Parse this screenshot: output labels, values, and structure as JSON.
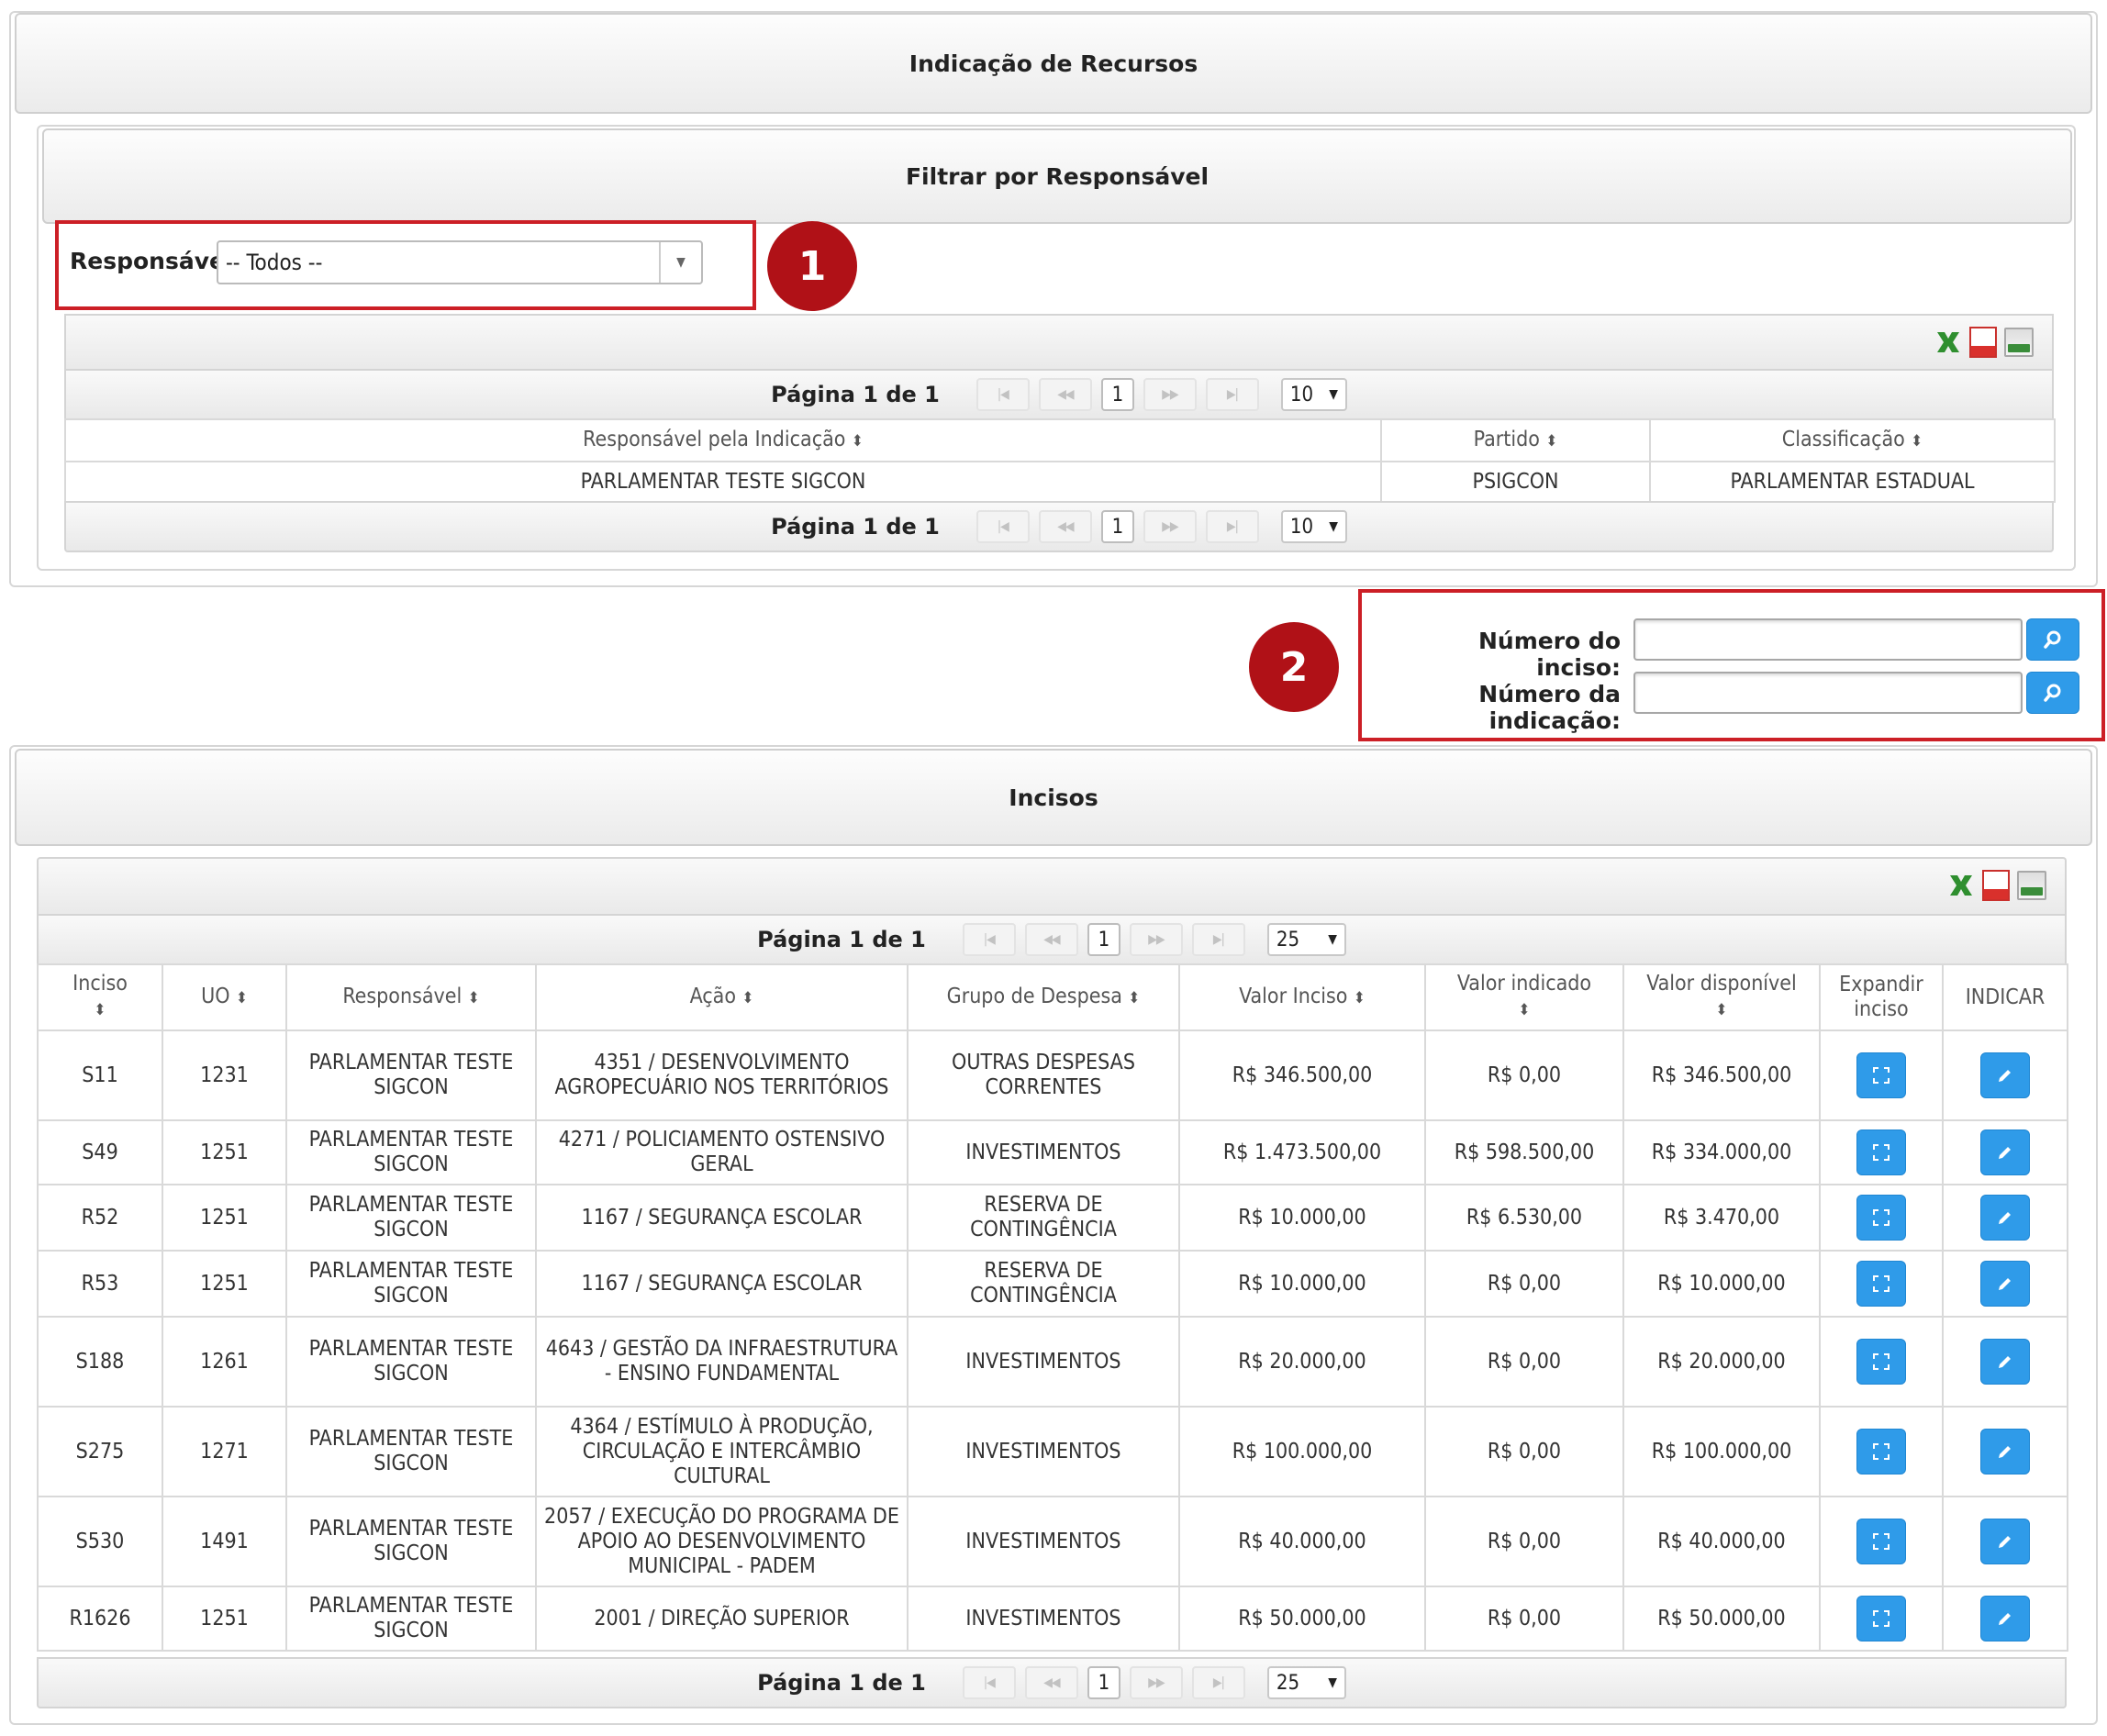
{
  "page": {
    "title": "Indicação de Recursos"
  },
  "filter": {
    "title": "Filtrar por Responsável",
    "label": "Responsável:",
    "selected": "-- Todos --"
  },
  "badges": {
    "one": "1",
    "two": "2"
  },
  "resp_table": {
    "pager": {
      "label": "Página 1 de 1",
      "current": "1",
      "size": "10"
    },
    "columns": [
      "Responsável pela Indicação",
      "Partido",
      "Classificação"
    ],
    "rows": [
      [
        "PARLAMENTAR TESTE SIGCON",
        "PSIGCON",
        "PARLAMENTAR ESTADUAL"
      ]
    ]
  },
  "search": {
    "inciso_label": "Número do inciso:",
    "indicacao_label": "Número da indicação:",
    "inciso_value": "",
    "indicacao_value": ""
  },
  "incisos": {
    "title": "Incisos",
    "pager": {
      "label": "Página 1 de 1",
      "current": "1",
      "size": "25"
    },
    "columns": [
      "Inciso",
      "UO",
      "Responsável",
      "Ação",
      "Grupo de Despesa",
      "Valor Inciso",
      "Valor indicado",
      "Valor disponível",
      "Expandir inciso",
      "INDICAR"
    ],
    "rows": [
      [
        "S11",
        "1231",
        "PARLAMENTAR TESTE SIGCON",
        "4351 / DESENVOLVIMENTO AGROPECUÁRIO NOS TERRITÓRIOS",
        "OUTRAS DESPESAS CORRENTES",
        "R$ 346.500,00",
        "R$ 0,00",
        "R$ 346.500,00"
      ],
      [
        "S49",
        "1251",
        "PARLAMENTAR TESTE SIGCON",
        "4271 / POLICIAMENTO OSTENSIVO GERAL",
        "INVESTIMENTOS",
        "R$ 1.473.500,00",
        "R$ 598.500,00",
        "R$ 334.000,00"
      ],
      [
        "R52",
        "1251",
        "PARLAMENTAR TESTE SIGCON",
        "1167 / SEGURANÇA ESCOLAR",
        "RESERVA DE CONTINGÊNCIA",
        "R$ 10.000,00",
        "R$ 6.530,00",
        "R$ 3.470,00"
      ],
      [
        "R53",
        "1251",
        "PARLAMENTAR TESTE SIGCON",
        "1167 / SEGURANÇA ESCOLAR",
        "RESERVA DE CONTINGÊNCIA",
        "R$ 10.000,00",
        "R$ 0,00",
        "R$ 10.000,00"
      ],
      [
        "S188",
        "1261",
        "PARLAMENTAR TESTE SIGCON",
        "4643 / GESTÃO DA INFRAESTRUTURA - ENSINO FUNDAMENTAL",
        "INVESTIMENTOS",
        "R$ 20.000,00",
        "R$ 0,00",
        "R$ 20.000,00"
      ],
      [
        "S275",
        "1271",
        "PARLAMENTAR TESTE SIGCON",
        "4364 / ESTÍMULO À PRODUÇÃO, CIRCULAÇÃO E INTERCÂMBIO CULTURAL",
        "INVESTIMENTOS",
        "R$ 100.000,00",
        "R$ 0,00",
        "R$ 100.000,00"
      ],
      [
        "S530",
        "1491",
        "PARLAMENTAR TESTE SIGCON",
        "2057 / EXECUÇÃO DO PROGRAMA DE APOIO AO DESENVOLVIMENTO MUNICIPAL - PADEM",
        "INVESTIMENTOS",
        "R$ 40.000,00",
        "R$ 0,00",
        "R$ 40.000,00"
      ],
      [
        "R1626",
        "1251",
        "PARLAMENTAR TESTE SIGCON",
        "2001 / DIREÇÃO SUPERIOR",
        "INVESTIMENTOS",
        "R$ 50.000,00",
        "R$ 0,00",
        "R$ 50.000,00"
      ]
    ]
  },
  "icons": {
    "excel": "excel-export-icon",
    "pdf": "pdf-export-icon",
    "csv": "csv-export-icon",
    "expand": "expand-icon",
    "edit": "pencil-icon",
    "search": "magnifier-icon"
  },
  "colors": {
    "accent": "#2f9be9",
    "highlight": "#cc1f26",
    "badge": "#b01117"
  }
}
